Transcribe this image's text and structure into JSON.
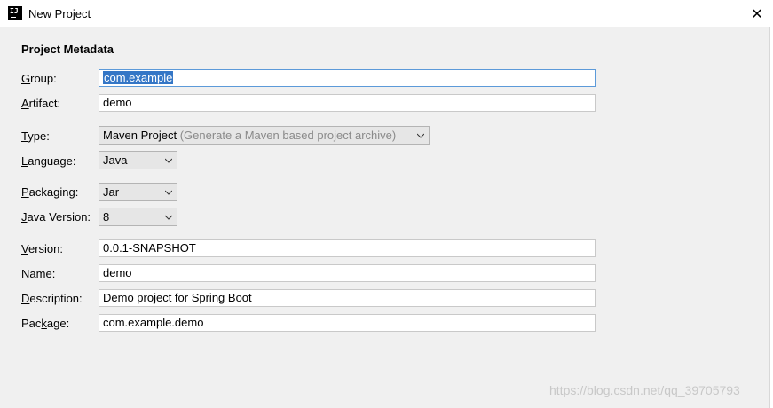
{
  "window": {
    "title": "New Project",
    "app_icon_text": "IJ",
    "close_glyph": "✕"
  },
  "section": {
    "title": "Project Metadata"
  },
  "fields": {
    "group": {
      "label_key": "G",
      "label_rest": "roup:",
      "value": "com.example"
    },
    "artifact": {
      "label_key": "A",
      "label_rest": "rtifact:",
      "value": "demo"
    },
    "type": {
      "label_pre": "",
      "label_key": "T",
      "label_rest": "ype:",
      "value": "Maven Project",
      "hint": "(Generate a Maven based project archive)"
    },
    "language": {
      "label_pre": "",
      "label_key": "L",
      "label_rest": "anguage:",
      "value": "Java"
    },
    "packaging": {
      "label_pre": "",
      "label_key": "P",
      "label_rest": "ackaging:",
      "value": "Jar"
    },
    "java_version": {
      "label_pre": "",
      "label_key": "J",
      "label_rest": "ava Version:",
      "value": "8"
    },
    "version": {
      "label_pre": "",
      "label_key": "V",
      "label_rest": "ersion:",
      "value": "0.0.1-SNAPSHOT"
    },
    "name": {
      "label_pre": "Na",
      "label_key": "m",
      "label_rest": "e:",
      "value": "demo"
    },
    "description": {
      "label_pre": "",
      "label_key": "D",
      "label_rest": "escription:",
      "value": "Demo project for Spring Boot"
    },
    "package": {
      "label_pre": "Pac",
      "label_key": "k",
      "label_rest": "age:",
      "value": "com.example.demo"
    }
  },
  "watermark": "https://blog.csdn.net/qq_39705793",
  "colors": {
    "selection": "#3476c6",
    "focus_border": "#5c9ad9",
    "panel_bg": "#f0f0f0"
  }
}
